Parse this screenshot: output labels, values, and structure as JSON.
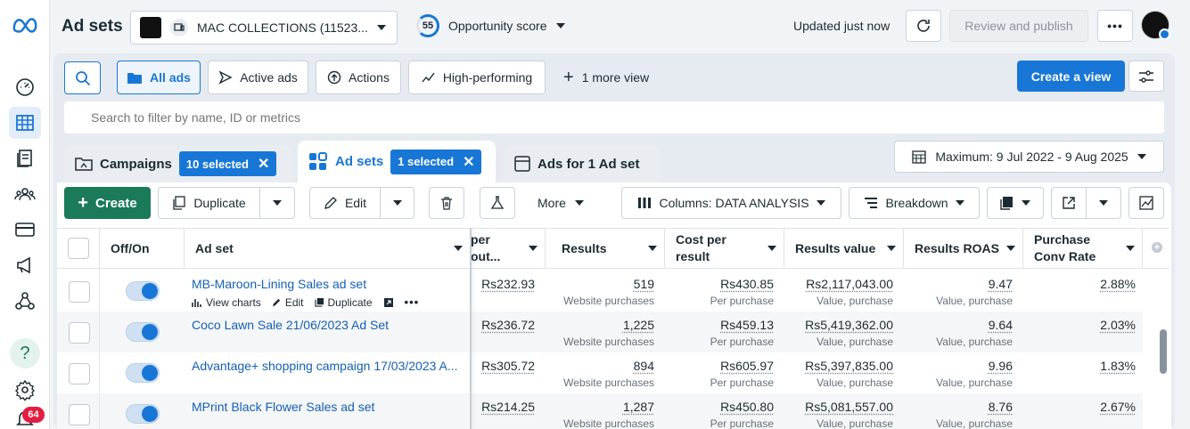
{
  "header": {
    "title": "Ad sets",
    "account_name": "MAC COLLECTIONS (11523...",
    "opportunity_score": "55",
    "opportunity_label": "Opportunity score",
    "updated_text": "Updated just now",
    "review_publish_label": "Review and publish",
    "more_label": "•••"
  },
  "rail": {
    "notification_count": "64",
    "help_label": "?"
  },
  "views": {
    "all_ads": "All ads",
    "active_ads": "Active ads",
    "actions": "Actions",
    "high_performing": "High-performing",
    "more_view": "1 more view",
    "create_view": "Create a view"
  },
  "search": {
    "placeholder": "Search to filter by name, ID or metrics"
  },
  "tabs": {
    "campaigns_label": "Campaigns",
    "campaigns_chip": "10 selected",
    "adsets_label": "Ad sets",
    "adsets_chip": "1 selected",
    "ads_label": "Ads for 1 Ad set",
    "date_range": "Maximum: 9 Jul 2022 - 9 Aug 2025"
  },
  "toolbar": {
    "create": "Create",
    "duplicate": "Duplicate",
    "edit": "Edit",
    "more": "More",
    "columns": "Columns: DATA ANALYSIS",
    "breakdown": "Breakdown"
  },
  "table": {
    "headers": {
      "offon": "Off/On",
      "adset": "Ad set",
      "cpo_line1": "per",
      "cpo_line2": "out...",
      "results": "Results",
      "cpr_line1": "Cost per",
      "cpr_line2": "result",
      "results_value": "Results value",
      "roas": "Results ROAS",
      "pcr_line1": "Purchase",
      "pcr_line2": "Conv Rate"
    },
    "row_actions": {
      "view_charts": "View charts",
      "edit": "Edit",
      "duplicate": "Duplicate"
    },
    "rows": [
      {
        "name": "MB-Maroon-Lining Sales ad set",
        "cpo": "Rs232.93",
        "results": "519",
        "results_sub": "Website purchases",
        "cpr": "Rs430.85",
        "cpr_sub": "Per purchase",
        "value": "Rs2,117,043.00",
        "value_sub": "Value, purchase",
        "roas": "9.47",
        "roas_sub": "Value, purchase",
        "pcr": "2.88%"
      },
      {
        "name": "Coco Lawn Sale 21/06/2023 Ad Set",
        "cpo": "Rs236.72",
        "results": "1,225",
        "results_sub": "Website purchases",
        "cpr": "Rs459.13",
        "cpr_sub": "Per purchase",
        "value": "Rs5,419,362.00",
        "value_sub": "Value, purchase",
        "roas": "9.64",
        "roas_sub": "Value, purchase",
        "pcr": "2.03%"
      },
      {
        "name": "Advantage+ shopping campaign 17/03/2023 A...",
        "cpo": "Rs305.72",
        "results": "894",
        "results_sub": "Website purchases",
        "cpr": "Rs605.97",
        "cpr_sub": "Per purchase",
        "value": "Rs5,397,835.00",
        "value_sub": "Value, purchase",
        "roas": "9.96",
        "roas_sub": "Value, purchase",
        "pcr": "1.83%"
      },
      {
        "name": "MPrint Black Flower Sales ad set",
        "cpo": "Rs214.25",
        "results": "1,287",
        "results_sub": "Website purchases",
        "cpr": "Rs450.80",
        "cpr_sub": "Per purchase",
        "value": "Rs5,081,557.00",
        "value_sub": "Value, purchase",
        "roas": "8.76",
        "roas_sub": "Value, purchase",
        "pcr": "2.67%"
      }
    ]
  },
  "colors": {
    "accent": "#1877d6",
    "create_green": "#1a7a5a"
  }
}
